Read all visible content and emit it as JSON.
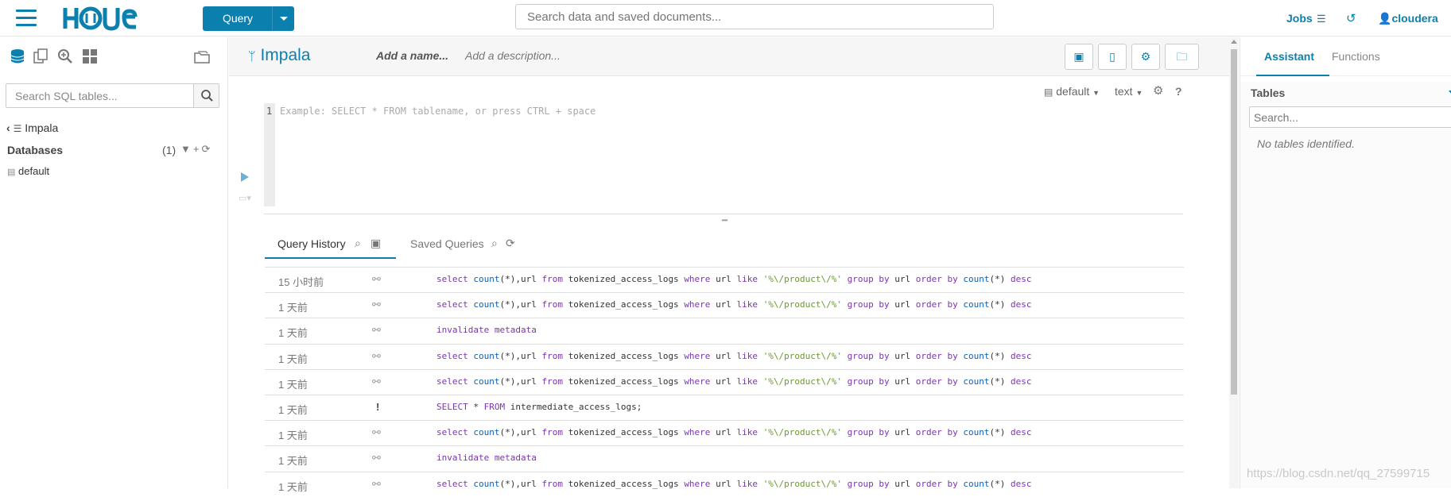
{
  "header": {
    "query_label": "Query",
    "search_placeholder": "Search data and saved documents...",
    "jobs_label": "Jobs",
    "user_label": "cloudera"
  },
  "left_panel": {
    "search_placeholder": "Search SQL tables...",
    "source_label": "Impala",
    "databases_label": "Databases",
    "databases_count": "(1)",
    "databases": [
      "default"
    ]
  },
  "editor": {
    "engine_label": "Impala",
    "name_placeholder": "Add a name...",
    "description_placeholder": "Add a description...",
    "database_label": "default",
    "format_label": "text",
    "line_number": "1",
    "placeholder": "Example: SELECT * FROM tablename, or press CTRL + space"
  },
  "tabs": {
    "history_label": "Query History",
    "saved_label": "Saved Queries"
  },
  "history": [
    {
      "time": "15 小时前",
      "status": "ok",
      "sql_type": "count"
    },
    {
      "time": "1 天前",
      "status": "ok",
      "sql_type": "count"
    },
    {
      "time": "1 天前",
      "status": "ok",
      "sql_type": "invalidate"
    },
    {
      "time": "1 天前",
      "status": "ok",
      "sql_type": "count"
    },
    {
      "time": "1 天前",
      "status": "ok",
      "sql_type": "count"
    },
    {
      "time": "1 天前",
      "status": "error",
      "sql_type": "select_all"
    },
    {
      "time": "1 天前",
      "status": "ok",
      "sql_type": "count"
    },
    {
      "time": "1 天前",
      "status": "ok",
      "sql_type": "invalidate"
    },
    {
      "time": "1 天前",
      "status": "ok",
      "sql_type": "count"
    }
  ],
  "sql_tokens": {
    "select": "select",
    "count": "count",
    "star_args": "(*),url",
    "from": "from",
    "table": "tokenized_access_logs",
    "where": "where",
    "url": "url",
    "like": "like",
    "pattern": "'%\\/product\\/%'",
    "group": "group",
    "by": "by",
    "order": "order",
    "count_arg": "(*)",
    "desc": "desc",
    "invalidate": "invalidate",
    "metadata": "metadata",
    "select_upper": "SELECT",
    "star": "*",
    "from_upper": "FROM",
    "table2": "intermediate_access_logs;"
  },
  "right_panel": {
    "assistant_label": "Assistant",
    "functions_label": "Functions",
    "tables_label": "Tables",
    "search_placeholder": "Search...",
    "empty_text": "No tables identified."
  },
  "watermark": "https://blog.csdn.net/qq_27599715",
  "colors": {
    "accent": "#0b7fad",
    "keyword": "#7a35b0",
    "string": "#6a9a2b"
  }
}
